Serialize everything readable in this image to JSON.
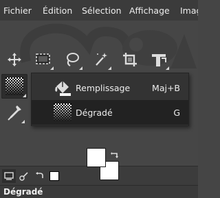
{
  "menubar": {
    "items": [
      {
        "label": "Fichier"
      },
      {
        "label": "Édition"
      },
      {
        "label": "Sélection"
      },
      {
        "label": "Affichage"
      },
      {
        "label": "Imag"
      }
    ]
  },
  "toolbox": {
    "tools": [
      {
        "name": "move-tool",
        "icon": "move-icon"
      },
      {
        "name": "rect-select-tool",
        "icon": "rect-select-icon"
      },
      {
        "name": "lasso-tool",
        "icon": "lasso-icon"
      },
      {
        "name": "fuzzy-select-tool",
        "icon": "magic-wand-icon"
      },
      {
        "name": "crop-tool",
        "icon": "crop-icon"
      },
      {
        "name": "unified-transform-tool",
        "icon": "transform-icon"
      },
      {
        "name": "gradient-tool",
        "icon": "gradient-icon",
        "active": true
      },
      {
        "name": "color-picker-tool",
        "icon": "eyedropper-icon"
      }
    ]
  },
  "popup": {
    "items": [
      {
        "label": "Remplissage",
        "shortcut": "Maj+B",
        "icon": "bucket-fill-icon",
        "active": false
      },
      {
        "label": "Dégradé",
        "shortcut": "G",
        "icon": "gradient-icon",
        "active": true
      }
    ]
  },
  "colors": {
    "foreground": "#ffffff",
    "background": "#ffffff"
  },
  "tabs": [
    {
      "icon": "tool-options-icon"
    },
    {
      "icon": "device-status-icon"
    },
    {
      "icon": "undo-history-icon"
    },
    {
      "icon": "images-icon"
    }
  ],
  "panel": {
    "title": "Dégradé"
  }
}
